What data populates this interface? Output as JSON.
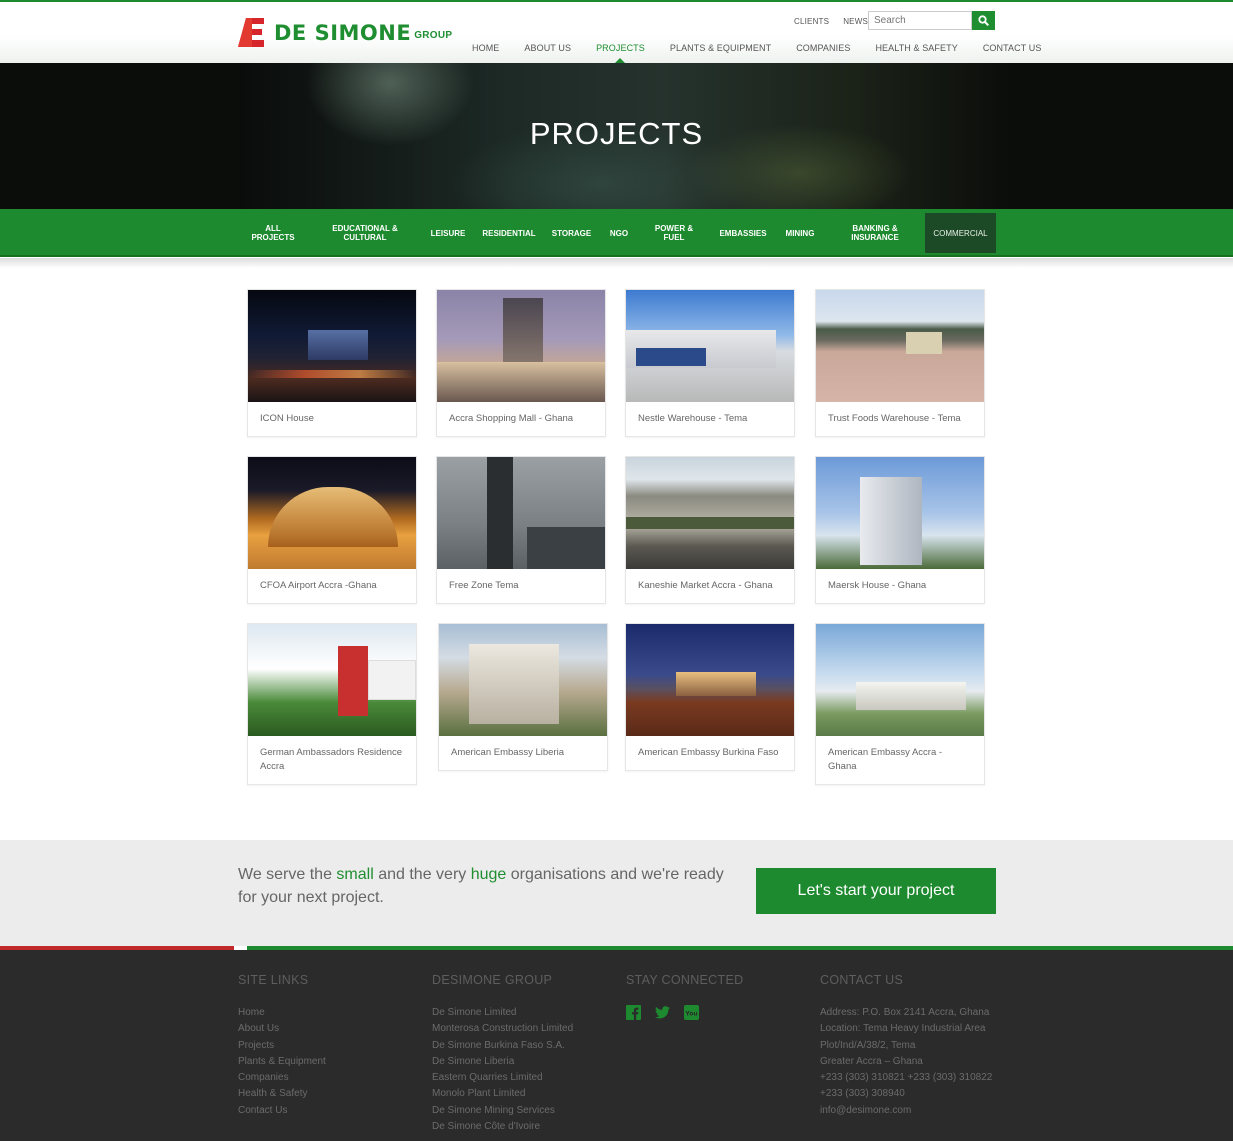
{
  "header": {
    "logo_text": "DE SIMONE",
    "logo_sub": "GROUP",
    "top_links": [
      "CLIENTS",
      "NEWS"
    ],
    "search_placeholder": "Search",
    "nav": [
      "HOME",
      "ABOUT US",
      "PROJECTS",
      "PLANTS & EQUIPMENT",
      "COMPANIES",
      "HEALTH & SAFETY",
      "CONTACT US"
    ],
    "active_nav": "PROJECTS"
  },
  "hero": {
    "title": "PROJECTS"
  },
  "categories": [
    {
      "label": "ALL PROJECTS",
      "line1": "ALL",
      "line2": "PROJECTS"
    },
    {
      "label": "EDUCATIONAL & CULTURAL",
      "line1": "EDUCATIONAL &",
      "line2": "CULTURAL"
    },
    {
      "label": "LEISURE",
      "line1": "LEISURE",
      "line2": ""
    },
    {
      "label": "RESIDENTIAL",
      "line1": "RESIDENTIAL",
      "line2": ""
    },
    {
      "label": "STORAGE",
      "line1": "STORAGE",
      "line2": ""
    },
    {
      "label": "NGO",
      "line1": "NGO",
      "line2": ""
    },
    {
      "label": "POWER & FUEL",
      "line1": "POWER &",
      "line2": "FUEL"
    },
    {
      "label": "EMBASSIES",
      "line1": "EMBASSIES",
      "line2": ""
    },
    {
      "label": "MINING",
      "line1": "MINING",
      "line2": ""
    },
    {
      "label": "BANKING & INSURANCE",
      "line1": "BANKING &",
      "line2": "INSURANCE"
    },
    {
      "label": "COMMERCIAL",
      "line1": "COMMERCIAL",
      "line2": ""
    }
  ],
  "active_category": "COMMERCIAL",
  "projects": [
    {
      "caption": "ICON House"
    },
    {
      "caption": "Accra Shopping Mall - Ghana"
    },
    {
      "caption": "Nestle Warehouse - Tema"
    },
    {
      "caption": "Trust Foods Warehouse - Tema"
    },
    {
      "caption": "CFOA Airport Accra -Ghana"
    },
    {
      "caption": "Free Zone Tema"
    },
    {
      "caption": "Kaneshie Market Accra - Ghana"
    },
    {
      "caption": "Maersk House - Ghana"
    },
    {
      "caption": "German Ambassadors Residence Accra"
    },
    {
      "caption": "American Embassy Liberia"
    },
    {
      "caption": "American Embassy Burkina Faso"
    },
    {
      "caption": "American Embassy Accra - Ghana"
    }
  ],
  "cta": {
    "text_1": "We serve the ",
    "highlight_1": "small",
    "text_2": " and the very ",
    "highlight_2": "huge",
    "text_3": " organisations and we're ready for your next project.",
    "button": "Let's start your project"
  },
  "footer": {
    "site_links": {
      "title": "SITE LINKS",
      "items": [
        "Home",
        "About Us",
        "Projects",
        "Plants & Equipment",
        "Companies",
        "Health & Safety",
        "Contact Us"
      ]
    },
    "group": {
      "title": "DESIMONE GROUP",
      "items": [
        "De Simone Limited",
        "Monterosa Construction Limited",
        "De Simone Burkina Faso S.A.",
        "De Simone Liberia",
        "Eastern Quarries Limited",
        "Monolo Plant Limited",
        "De Simone Mining Services",
        "De Simone Côte d'Ivoire"
      ]
    },
    "connected": {
      "title": "STAY CONNECTED",
      "icons": [
        "facebook-icon",
        "twitter-icon",
        "youtube-icon"
      ]
    },
    "contact": {
      "title": "CONTACT US",
      "items": [
        "Address: P.O. Box 2141 Accra, Ghana",
        "Location: Tema Heavy Industrial Area",
        "Plot/Ind/A/38/2, Tema",
        "Greater Accra – Ghana",
        "+233 (303) 310821 +233 (303) 310822",
        "+233 (303) 308940",
        "info@desimone.com"
      ]
    }
  },
  "colors": {
    "brand_green": "#1e8a2f",
    "brand_red": "#d7262b",
    "footer_bg": "#2b2b2b"
  }
}
